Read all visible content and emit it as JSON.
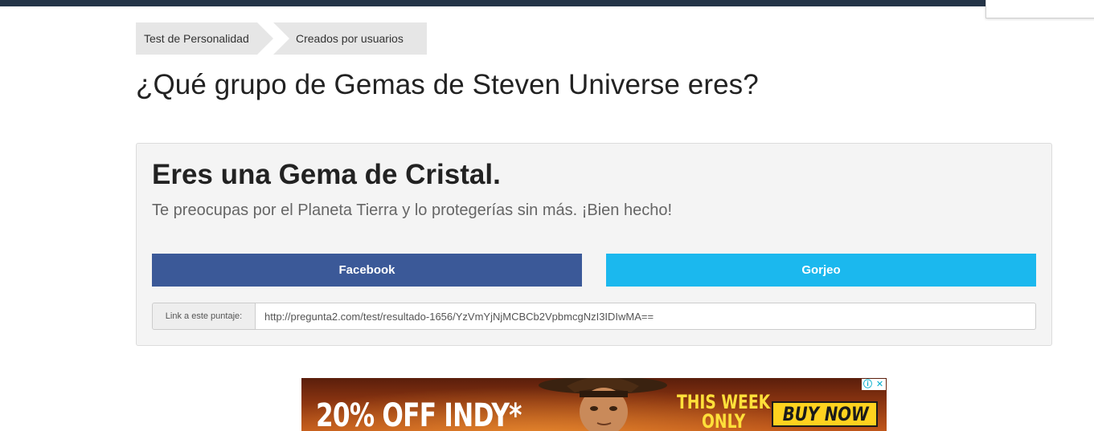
{
  "breadcrumb": {
    "items": [
      {
        "label": "Test de Personalidad"
      },
      {
        "label": "Creados por usuarios"
      }
    ]
  },
  "page": {
    "title": "¿Qué grupo de Gemas de Steven Universe eres?"
  },
  "result": {
    "title": "Eres una Gema de Cristal.",
    "description": "Te preocupas por el Planeta Tierra y lo protegerías sin más. ¡Bien hecho!",
    "share": {
      "facebook_label": "Facebook",
      "twitter_label": "Gorjeo"
    },
    "link": {
      "label": "Link a este puntaje:",
      "url": "http://pregunta2.com/test/resultado-1656/YzVmYjNjMCBCb2VpbmcgNzI3IDIwMA=="
    }
  },
  "ad": {
    "offer_text": "20% OFF INDY*",
    "week_line1": "THIS WEEK",
    "week_line2": "ONLY",
    "buy_label": "BUY NOW",
    "adchoices_icon": "info-icon",
    "close_icon": "close-icon"
  },
  "colors": {
    "topbar": "#243447",
    "facebook": "#3b5998",
    "twitter": "#1bb8ee",
    "breadcrumb_bg": "#e6e6e6",
    "panel_bg": "#f4f4f4",
    "ad_yellow": "#ffd21f"
  }
}
